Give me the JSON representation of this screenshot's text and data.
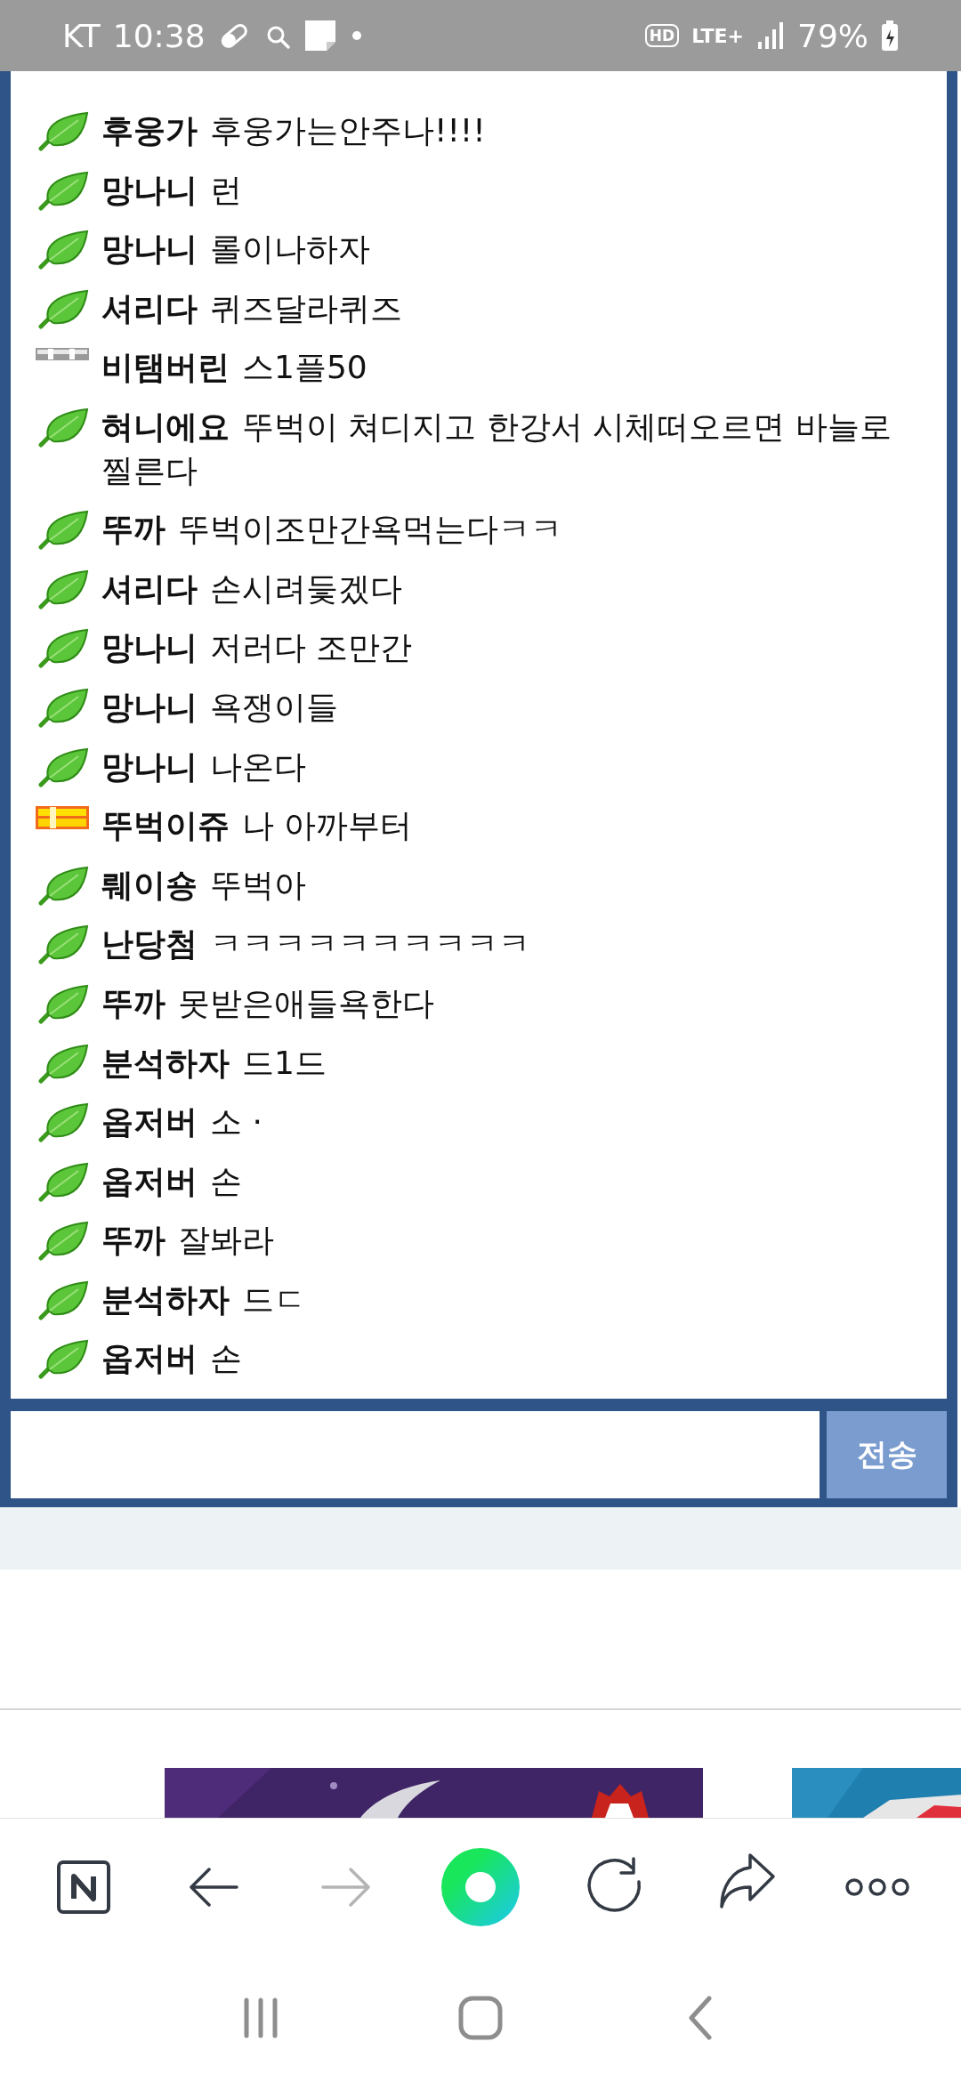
{
  "status_bar": {
    "carrier": "KT",
    "time": "10:38",
    "hd": "HD",
    "network": "LTE+",
    "battery": "79%"
  },
  "chat": {
    "messages": [
      {
        "kind": "leaf",
        "name": "후웅가",
        "text": "후웅가는안주나!!!!"
      },
      {
        "kind": "leaf",
        "name": "망나니",
        "text": "런"
      },
      {
        "kind": "leaf",
        "name": "망나니",
        "text": "롤이나하자"
      },
      {
        "kind": "leaf",
        "name": "셔리다",
        "text": "퀴즈달라퀴즈"
      },
      {
        "kind": "silver",
        "name": "비탬버린",
        "text": "스1플50"
      },
      {
        "kind": "leaf",
        "name": "혀니에요",
        "text": "뚜벅이 쳐디지고 한강서 시체떠오르면 바늘로 찔른다"
      },
      {
        "kind": "leaf",
        "name": "뚜까",
        "text": "뚜벅이조만간욕먹는다ㅋㅋ"
      },
      {
        "kind": "leaf",
        "name": "셔리다",
        "text": "손시려듳겠다"
      },
      {
        "kind": "leaf",
        "name": "망나니",
        "text": "저러다 조만간"
      },
      {
        "kind": "leaf",
        "name": "망나니",
        "text": "욕쟁이들"
      },
      {
        "kind": "leaf",
        "name": "망나니",
        "text": "나온다"
      },
      {
        "kind": "gold",
        "name": "뚜벅이쥬",
        "text": "나 아까부터"
      },
      {
        "kind": "leaf",
        "name": "뤠이숑",
        "text": "뚜벅아"
      },
      {
        "kind": "leaf",
        "name": "난당첨",
        "text": "ㅋㅋㅋㅋㅋㅋㅋㅋㅋㅋ"
      },
      {
        "kind": "leaf",
        "name": "뚜까",
        "text": "못받은애들욕한다"
      },
      {
        "kind": "leaf",
        "name": "분석하자",
        "text": "드1드"
      },
      {
        "kind": "leaf",
        "name": "옵저버",
        "text": "소 ·"
      },
      {
        "kind": "leaf",
        "name": "옵저버",
        "text": "손"
      },
      {
        "kind": "leaf",
        "name": "뚜까",
        "text": "잘봐라"
      },
      {
        "kind": "leaf",
        "name": "분석하자",
        "text": "드ㄷ"
      },
      {
        "kind": "leaf",
        "name": "옵저버",
        "text": "손"
      }
    ],
    "send_button": "전송"
  }
}
